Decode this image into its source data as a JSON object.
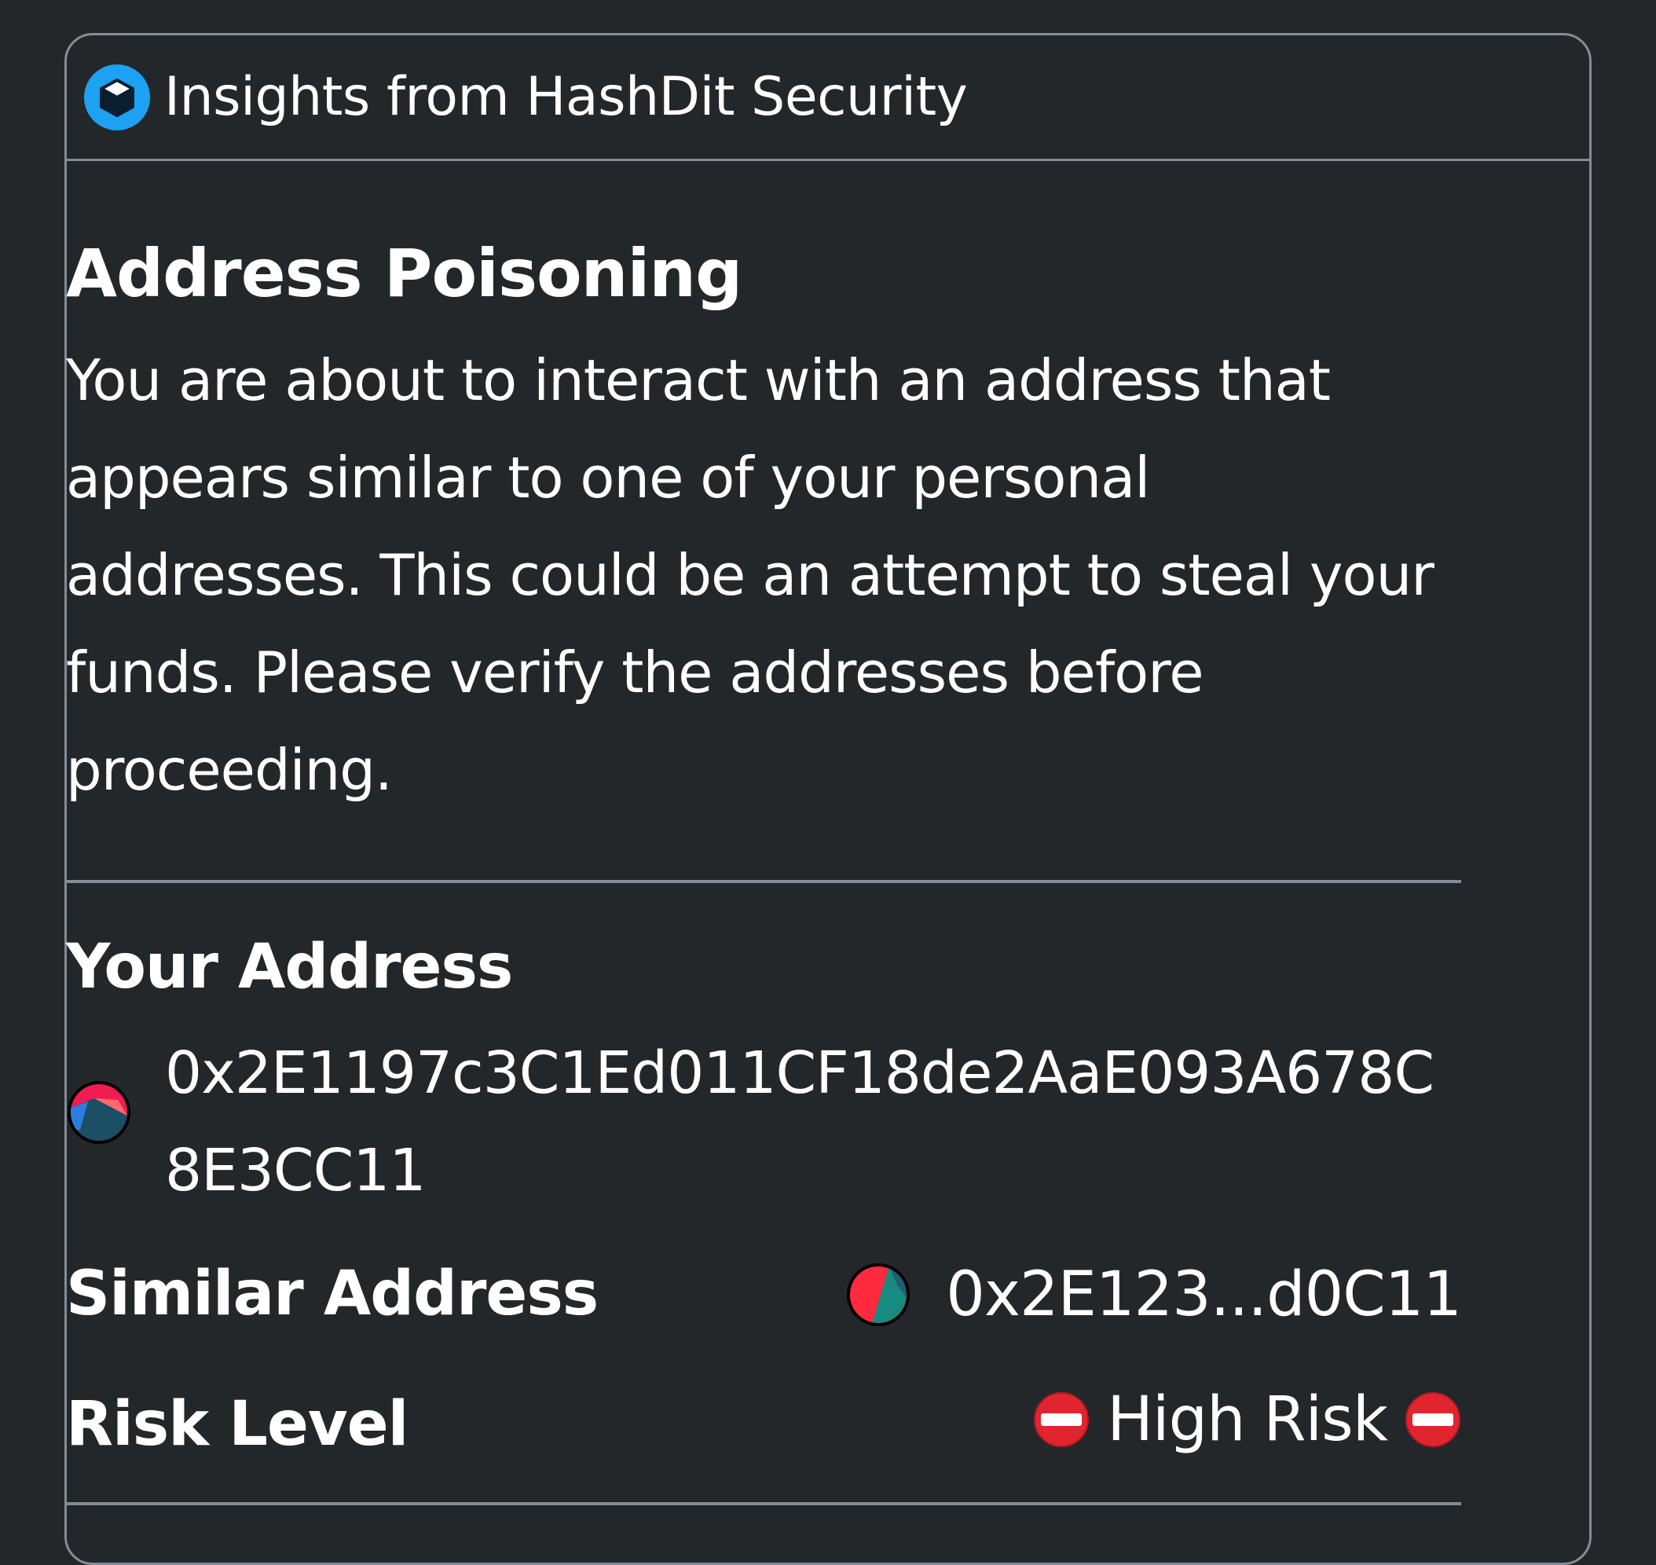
{
  "header": {
    "title": "Insights from HashDit Security",
    "logo_icon": "cube-icon",
    "logo_color": "#1da1f2"
  },
  "insight": {
    "title": "Address Poisoning",
    "description": "You are about to interact with an address that appears similar to one of your personal addresses. This could be an attempt to steal your funds. Please verify the addresses before proceeding."
  },
  "your_address": {
    "label": "Your Address",
    "value": "0x2E1197c3C1Ed011CF18de2AaE093A678C8E3CC11"
  },
  "similar_address": {
    "label": "Similar Address",
    "value": "0x2E123...d0C11"
  },
  "risk": {
    "label": "Risk Level",
    "value": "High Risk",
    "icon": "no-entry-icon",
    "color": "#e0252f"
  },
  "colors": {
    "background": "#24272a",
    "border": "#848c96",
    "text": "#ffffff"
  }
}
